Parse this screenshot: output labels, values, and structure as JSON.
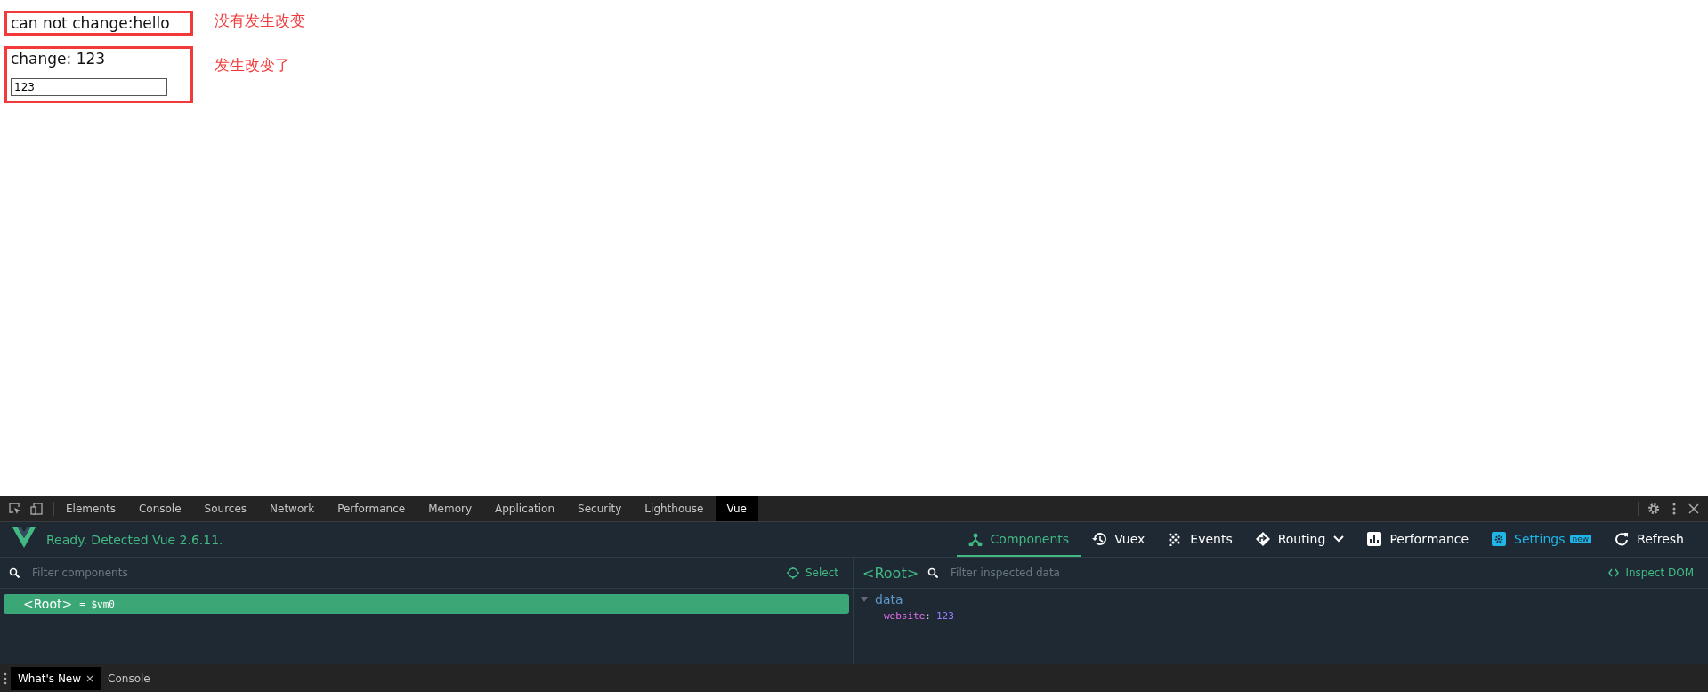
{
  "page": {
    "blocks": [
      {
        "kind": "text",
        "text": "can not change:hello",
        "note": "没有发生改变"
      },
      {
        "kind": "input",
        "text": "change: 123",
        "value": "123",
        "note": "发生改变了"
      }
    ]
  },
  "devtools": {
    "tabs": [
      {
        "label": "Elements",
        "selected": false
      },
      {
        "label": "Console",
        "selected": false
      },
      {
        "label": "Sources",
        "selected": false
      },
      {
        "label": "Network",
        "selected": false
      },
      {
        "label": "Performance",
        "selected": false
      },
      {
        "label": "Memory",
        "selected": false
      },
      {
        "label": "Application",
        "selected": false
      },
      {
        "label": "Security",
        "selected": false
      },
      {
        "label": "Lighthouse",
        "selected": false
      },
      {
        "label": "Vue",
        "selected": true
      }
    ],
    "vue": {
      "status": "Ready. Detected Vue 2.6.11.",
      "nav": [
        {
          "kind": "components",
          "label": "Components",
          "selected": true
        },
        {
          "kind": "vuex",
          "label": "Vuex",
          "selected": false
        },
        {
          "kind": "events",
          "label": "Events",
          "selected": false
        },
        {
          "kind": "routing",
          "label": "Routing",
          "selected": false,
          "dropdown": true
        },
        {
          "kind": "performance",
          "label": "Performance",
          "selected": false
        },
        {
          "kind": "settings",
          "label": "Settings",
          "selected": false,
          "badge": "new"
        },
        {
          "kind": "refresh",
          "label": "Refresh",
          "selected": false
        }
      ]
    },
    "components": {
      "placeholder": "Filter components",
      "select": "Select",
      "tree": [
        {
          "name": "<Root>",
          "suffix": "= $vm0",
          "selected": true
        }
      ]
    },
    "inspector": {
      "title": "<Root>",
      "placeholder": "Filter inspected data",
      "inspect": "Inspect DOM",
      "sections": [
        {
          "name": "data",
          "expanded": true,
          "props": [
            {
              "key": "website",
              "separator": ":",
              "value": "123"
            }
          ]
        }
      ]
    },
    "drawer": {
      "tabs": [
        {
          "label": "What's New",
          "selected": true,
          "closable": true
        },
        {
          "label": "Console",
          "selected": false,
          "closable": false
        }
      ]
    }
  }
}
